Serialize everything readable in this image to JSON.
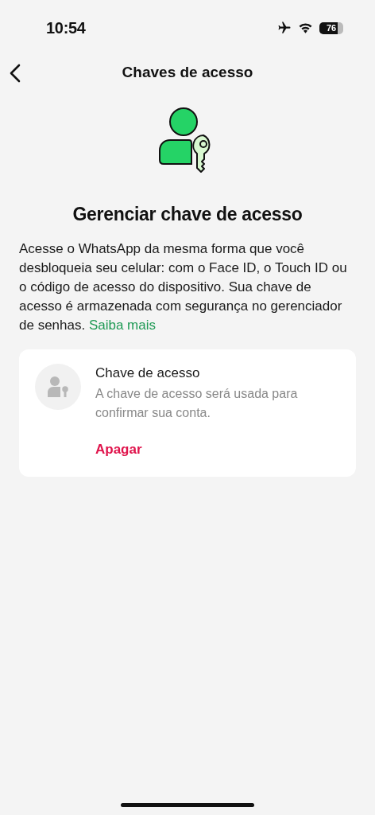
{
  "status_bar": {
    "time": "10:54",
    "airplane_mode": true,
    "battery": "76"
  },
  "nav": {
    "title": "Chaves de acesso"
  },
  "heading": "Gerenciar chave de acesso",
  "description": {
    "text": "Acesse o WhatsApp da mesma forma que você desbloqueia seu celular: com o Face ID, o Touch ID ou o código de acesso do dispositivo. Sua chave de acesso é armazenada com segurança no gerenciador de senhas.",
    "link": "Saiba mais"
  },
  "passkey_card": {
    "title": "Chave de acesso",
    "subtitle": "A chave de acesso será usada para confirmar sua conta.",
    "action": "Apagar"
  }
}
